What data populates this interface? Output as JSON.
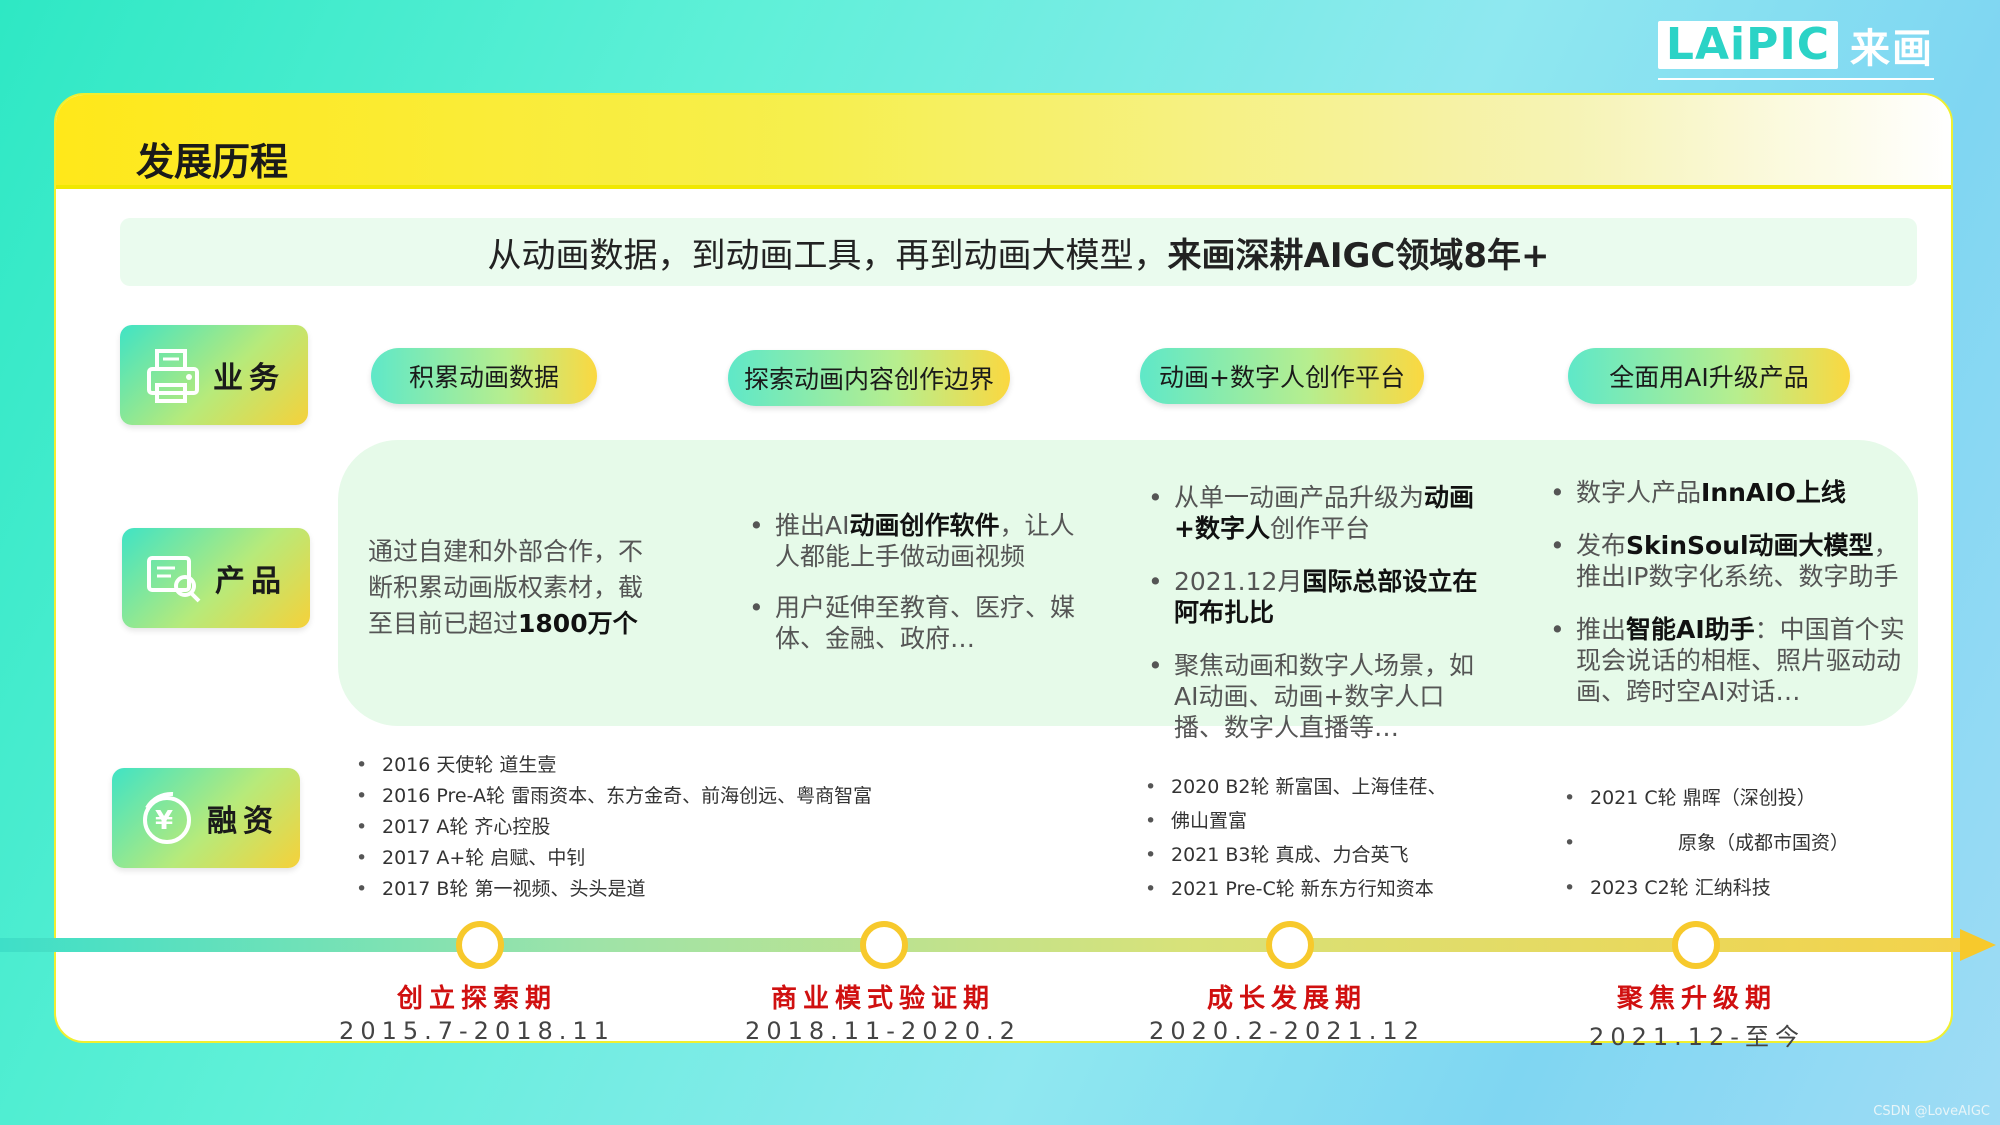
{
  "logo": {
    "latin": "LAiPIC",
    "cn": "来画"
  },
  "card": {
    "title": "发展历程"
  },
  "banner": {
    "prefix": "从动画数据，到动画工具，再到动画大模型，",
    "bold": "来画深耕AIGC领域8年+"
  },
  "categories": [
    {
      "label": "业务",
      "icon": "printer-icon"
    },
    {
      "label": "产品",
      "icon": "search-document-icon"
    },
    {
      "label": "融资",
      "icon": "yuan-coin-icon"
    }
  ],
  "business": [
    "积累动画数据",
    "探索动画内容创作边界",
    "动画+数字人创作平台",
    "全面用AI升级产品"
  ],
  "product": {
    "col1": {
      "p1": "通过自建和外部合作，不断积累动画版权素材，截至目前已超过",
      "b1": "1800万个"
    },
    "col2": [
      {
        "a": "推出AI",
        "b": "动画创作软件",
        "c": "，让人人都能上手做动画视频"
      },
      {
        "a": "用户延伸至教育、医疗、媒体、金融、政府…"
      }
    ],
    "col3": [
      {
        "a": "从单一动画产品升级为",
        "b": "动画+数字人",
        "c": "创作平台"
      },
      {
        "a": "2021.12月",
        "b": "国际总部设立在阿布扎比"
      },
      {
        "a": "聚焦动画和数字人场景，如AI动画、动画+数字人口播、数字人直播等…"
      }
    ],
    "col4": [
      {
        "a": "数字人产品",
        "b": "InnAIO上线"
      },
      {
        "a": "发布",
        "b": "SkinSoul动画大模型",
        "c": "，推出IP数字化系统、数字助手"
      },
      {
        "a": "推出",
        "b": "智能AI助手",
        "c": "：中国首个实现会说话的相框、照片驱动动画、跨时空AI对话…"
      }
    ]
  },
  "funding": {
    "col1": [
      "2016 天使轮 道生壹",
      "2016 Pre-A轮 雷雨资本、东方金奇、前海创远、粤商智富",
      "2017 A轮 齐心控股",
      "2017 A+轮 启赋、中钊",
      "2017 B轮 第一视频、头头是道"
    ],
    "col3": [
      "2020 B2轮 新富国、上海佳荏、",
      "佛山置富",
      "2021 B3轮 真成、力合英飞",
      "2021 Pre-C轮 新东方行知资本"
    ],
    "col4": [
      "2021 C轮 鼎晖（深创投）",
      "原象（成都市国资）",
      "2023 C2轮 汇纳科技"
    ]
  },
  "phases": [
    {
      "name": "创立探索期",
      "date": "2015.7-2018.11"
    },
    {
      "name": "商业模式验证期",
      "date": "2018.11-2020.2"
    },
    {
      "name": "成长发展期",
      "date": "2020.2-2021.12"
    },
    {
      "name": "聚焦升级期",
      "date": "2021.12-至今"
    }
  ],
  "colors": {
    "accent_yellow": "#f7c92c",
    "phase_red": "#d01010",
    "teal": "#2ee8c4"
  },
  "watermark": "CSDN @LoveAIGC"
}
